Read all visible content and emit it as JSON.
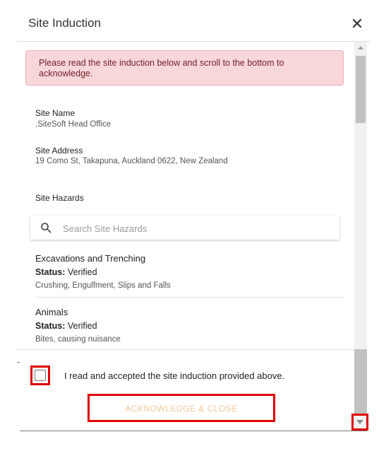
{
  "dialog": {
    "title": "Site Induction",
    "close_label": "✕"
  },
  "alert": {
    "text": "Please read the site induction below and scroll to the bottom to acknowledge.",
    "color": "#f8d7da"
  },
  "site": {
    "name_label": "Site Name",
    "name_value": ".SiteSoft Head Office",
    "address_label": "Site Address",
    "address_value": "19 Como St, Takapuna, Auckland 0622, New Zealand",
    "hazards_label": "Site Hazards"
  },
  "search": {
    "placeholder": "Search Site Hazards",
    "value": ""
  },
  "hazards": [
    {
      "name": "Excavations and Trenching",
      "status_label": "Status:",
      "status_value": "Verified",
      "description": "Crushing, Engulfment, Slips and Falls"
    },
    {
      "name": "Animals",
      "status_label": "Status:",
      "status_value": "Verified",
      "description": "Bites, causing nuisance"
    }
  ],
  "footer": {
    "checkbox_label": "I read and accepted the site induction provided above.",
    "checkbox_checked": false,
    "acknowledge_button": "ACKNOWLEDGE & CLOSE"
  },
  "colors": {
    "highlight": "#e00000",
    "button_disabled_text": "#f2c89a"
  }
}
